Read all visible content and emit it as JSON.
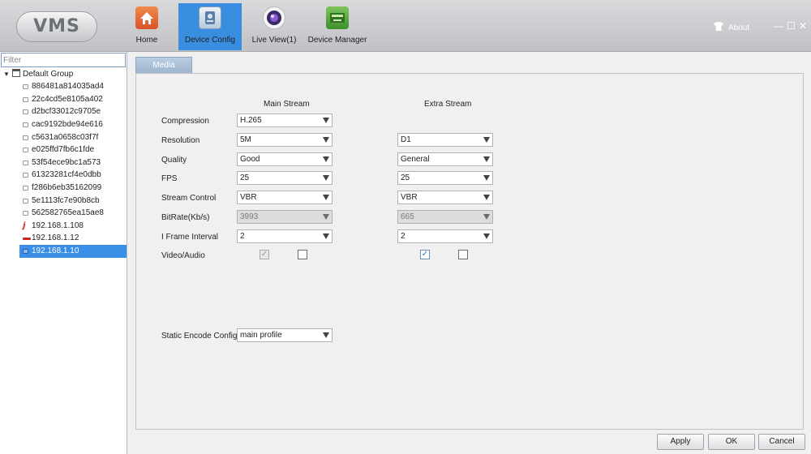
{
  "app": {
    "logo_text": "VMS"
  },
  "nav": {
    "tabs": [
      {
        "label": "Home",
        "icon": "home-icon"
      },
      {
        "label": "Device Config",
        "icon": "device-config-icon",
        "active": true
      },
      {
        "label": "Live View(1)",
        "icon": "camera-lens-icon"
      },
      {
        "label": "Device Manager",
        "icon": "device-manager-icon"
      }
    ],
    "about_label": "About",
    "window_controls": {
      "minimize": "—",
      "maximize": "☐",
      "close": "✕"
    }
  },
  "sidebar": {
    "filter_placeholder": "Filter",
    "root_label": "Default Group",
    "items": [
      {
        "label": "886481a814035ad4",
        "status": "offline"
      },
      {
        "label": "22c4cd5e8105a402",
        "status": "offline"
      },
      {
        "label": "d2bcf33012c9705e",
        "status": "offline"
      },
      {
        "label": "cac9192bde94e616",
        "status": "offline"
      },
      {
        "label": "c5631a0658c03f7f",
        "status": "offline"
      },
      {
        "label": "e025ffd7fb6c1fde",
        "status": "offline"
      },
      {
        "label": "53f54ece9bc1a573",
        "status": "offline"
      },
      {
        "label": "61323281cf4e0dbb",
        "status": "offline"
      },
      {
        "label": "f286b6eb35162099",
        "status": "offline"
      },
      {
        "label": "5e1113fc7e90b8cb",
        "status": "offline"
      },
      {
        "label": "562582765ea15ae8",
        "status": "offline"
      },
      {
        "label": "192.168.1.108",
        "status": "alert"
      },
      {
        "label": "192.168.1.12",
        "status": "error"
      },
      {
        "label": "192.168.1.10",
        "status": "online",
        "selected": true
      }
    ]
  },
  "media": {
    "tab_label": "Media",
    "main_stream_header": "Main Stream",
    "extra_stream_header": "Extra Stream",
    "rows": {
      "compression": {
        "label": "Compression",
        "main": "H.265"
      },
      "resolution": {
        "label": "Resolution",
        "main": "5M",
        "extra": "D1"
      },
      "quality": {
        "label": "Quality",
        "main": "Good",
        "extra": "General"
      },
      "fps": {
        "label": "FPS",
        "main": "25",
        "extra": "25"
      },
      "stream_control": {
        "label": "Stream Control",
        "main": "VBR",
        "extra": "VBR"
      },
      "bitrate": {
        "label": "BitRate(Kb/s)",
        "main": "3993",
        "extra": "665"
      },
      "iframe": {
        "label": "I Frame Interval",
        "main": "2",
        "extra": "2"
      },
      "video_audio": {
        "label": "Video/Audio",
        "main_video": true,
        "main_audio": false,
        "extra_video": true,
        "extra_audio": false
      },
      "static_encode": {
        "label": "Static Encode Config",
        "value": "main profile"
      }
    },
    "check_mark": "✓"
  },
  "footer": {
    "apply": "Apply",
    "ok": "OK",
    "cancel": "Cancel"
  },
  "colors": {
    "accent": "#3a8ee0",
    "selected_row": "#3b8ee6"
  }
}
